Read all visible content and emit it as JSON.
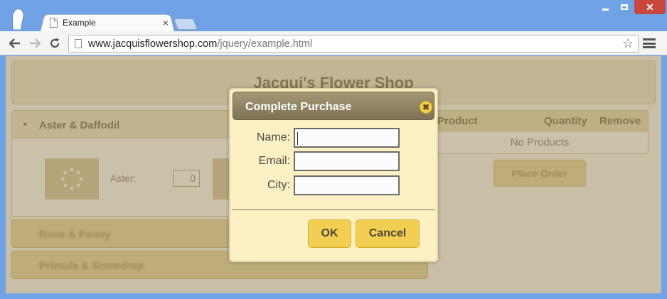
{
  "browser": {
    "tab_title": "Example",
    "tab_close": "×",
    "url_host": "www.jacquisflowershop.com",
    "url_path": "/jquery/example.html",
    "icons": {
      "back": "back-arrow-icon",
      "forward": "forward-arrow-icon",
      "reload": "reload-icon",
      "star": "star-icon",
      "menu": "hamburger-menu-icon"
    }
  },
  "page": {
    "shop_title": "Jacqui's Flower Shop",
    "accordion": {
      "section_1": "Aster & Daffodil",
      "item_label": "Aster:",
      "item_qty": "0",
      "section_2": "Rose & Peony",
      "section_3": "Primula & Snowdrop"
    },
    "cart": {
      "col_product": "Product",
      "col_quantity": "Quantity",
      "col_remove": "Remove",
      "empty_text": "No Products",
      "place_order": "Place Order"
    }
  },
  "dialog": {
    "title": "Complete Purchase",
    "close_glyph": "✖",
    "fields": {
      "name_label": "Name:",
      "name_value": "",
      "email_label": "Email:",
      "email_value": "",
      "city_label": "City:",
      "city_value": ""
    },
    "buttons": {
      "ok": "OK",
      "cancel": "Cancel"
    }
  },
  "colors": {
    "browser_frame": "#6fa3e6",
    "dialog_bg": "#fdf0c2",
    "dialog_title": "#8a7e60",
    "button": "#f2cf52",
    "close_button": "#c9473a"
  }
}
